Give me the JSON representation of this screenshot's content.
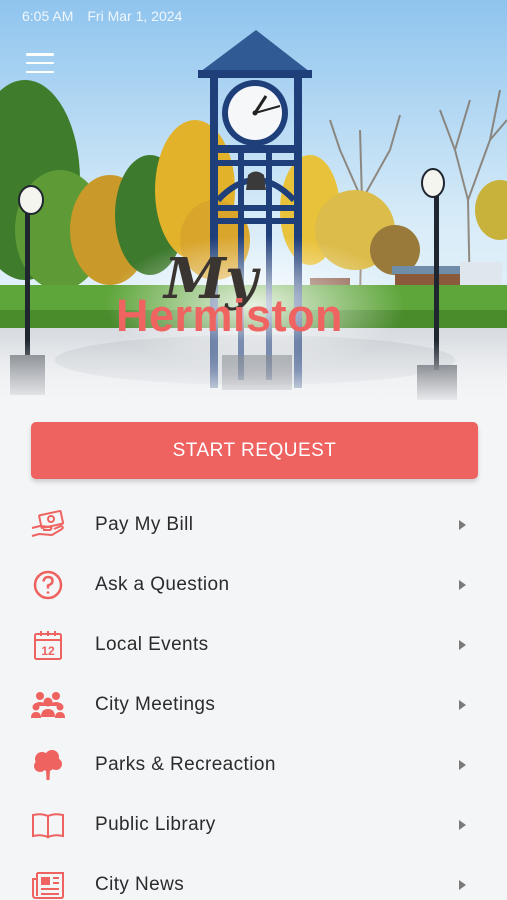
{
  "status_bar": {
    "time": "6:05 AM",
    "date": "Fri Mar 1, 2024"
  },
  "header": {
    "logo_top": "My",
    "logo_bottom": "Hermiston"
  },
  "start_request": {
    "label": "START REQUEST"
  },
  "menu": [
    {
      "label": "Pay My Bill",
      "icon": "bill-hand-icon"
    },
    {
      "label": "Ask a Question",
      "icon": "question-icon"
    },
    {
      "label": "Local Events",
      "icon": "calendar-icon"
    },
    {
      "label": "City Meetings",
      "icon": "group-icon"
    },
    {
      "label": "Parks & Recreaction",
      "icon": "tree-icon"
    },
    {
      "label": "Public Library",
      "icon": "book-icon"
    },
    {
      "label": "City News",
      "icon": "newspaper-icon"
    }
  ],
  "colors": {
    "accent": "#ee6260",
    "text": "#2b2b2b",
    "background": "#f4f5f7",
    "clock_tower": "#1f3f7a"
  }
}
